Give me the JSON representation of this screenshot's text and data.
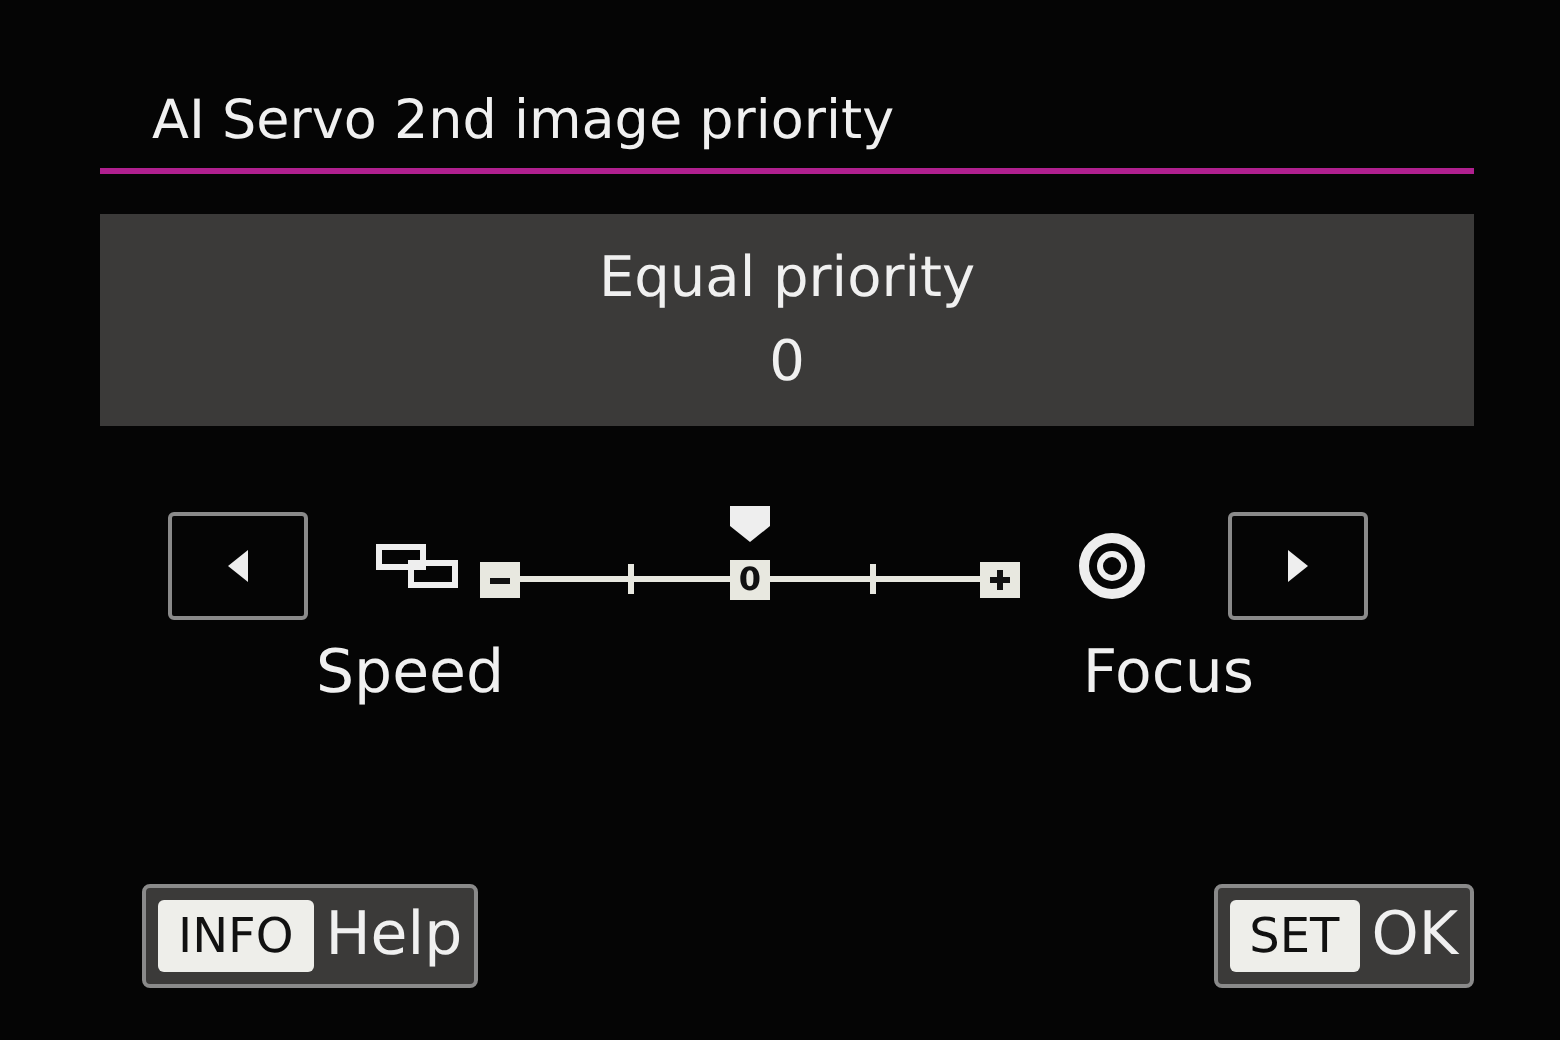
{
  "title": "AI Servo 2nd image priority",
  "setting": {
    "name": "Equal priority",
    "value": "0"
  },
  "slider": {
    "level": 0.5,
    "center_label": "0",
    "left_label": "Speed",
    "right_label": "Focus"
  },
  "buttons": [
    {
      "key": "INFO",
      "label": "Help"
    },
    {
      "key": "SET",
      "label": "OK"
    }
  ]
}
